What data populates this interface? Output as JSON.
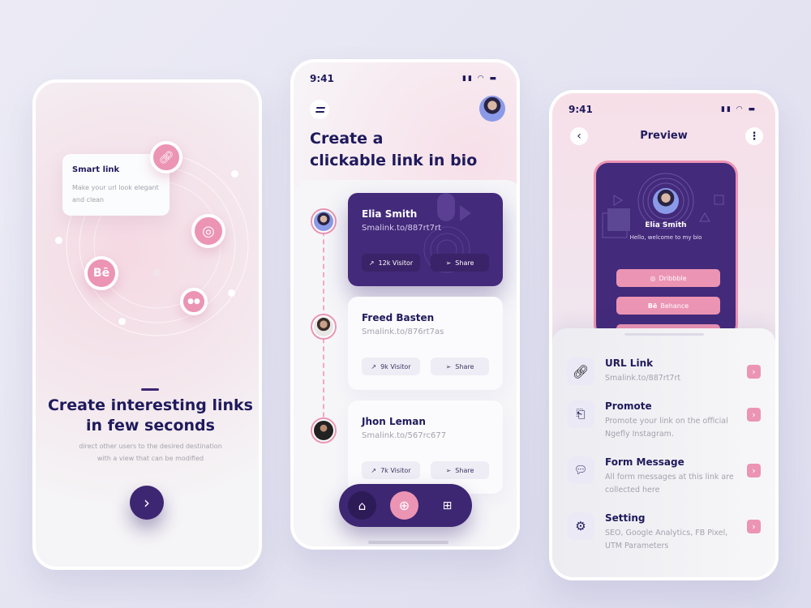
{
  "screen1": {
    "smart_link_title": "Smart link",
    "smart_link_desc": "Make your url look elegant and clean",
    "icons": [
      "link-icon",
      "dribbble-icon",
      "behance-icon",
      "flickr-icon"
    ],
    "behance_glyph": "Bē",
    "title": "Create interesting links in few seconds",
    "subtitle": "direct other users to the desired destination with a view that can be modified",
    "next_glyph": "›"
  },
  "screen2": {
    "time": "9:41",
    "title_line1": "Create a",
    "title_line2": "clickable link in bio",
    "cards": [
      {
        "name": "Elia Smith",
        "url": "Smalink.to/887rt7rt",
        "visitors": "12k Visitor",
        "share": "Share"
      },
      {
        "name": "Freed Basten",
        "url": "Smalink.to/876rt7as",
        "visitors": "9k Visitor",
        "share": "Share"
      },
      {
        "name": "Jhon Leman",
        "url": "Smalink.to/567rc677",
        "visitors": "7k Visitor",
        "share": "Share"
      }
    ],
    "nav": [
      "home-icon",
      "plus-icon",
      "grid-icon"
    ]
  },
  "screen3": {
    "time": "9:41",
    "title": "Preview",
    "preview_name": "Elia Smith",
    "preview_bio": "Hello, welcome to my bio",
    "buttons": [
      "Dribbble",
      "Behance"
    ],
    "behance_glyph": "Bē",
    "items": [
      {
        "title": "URL Link",
        "desc": "Smalink.to/887rt7rt"
      },
      {
        "title": "Promote",
        "desc": "Promote your link on the official Ngefly Instagram."
      },
      {
        "title": "Form Message",
        "desc": "All form messages at this link are collected here"
      },
      {
        "title": "Setting",
        "desc": "SEO, Google Analytics, FB Pixel, UTM Parameters"
      }
    ]
  },
  "colors": {
    "primary": "#432a7a",
    "accent": "#ec94b3",
    "text": "#1f1a5c"
  }
}
